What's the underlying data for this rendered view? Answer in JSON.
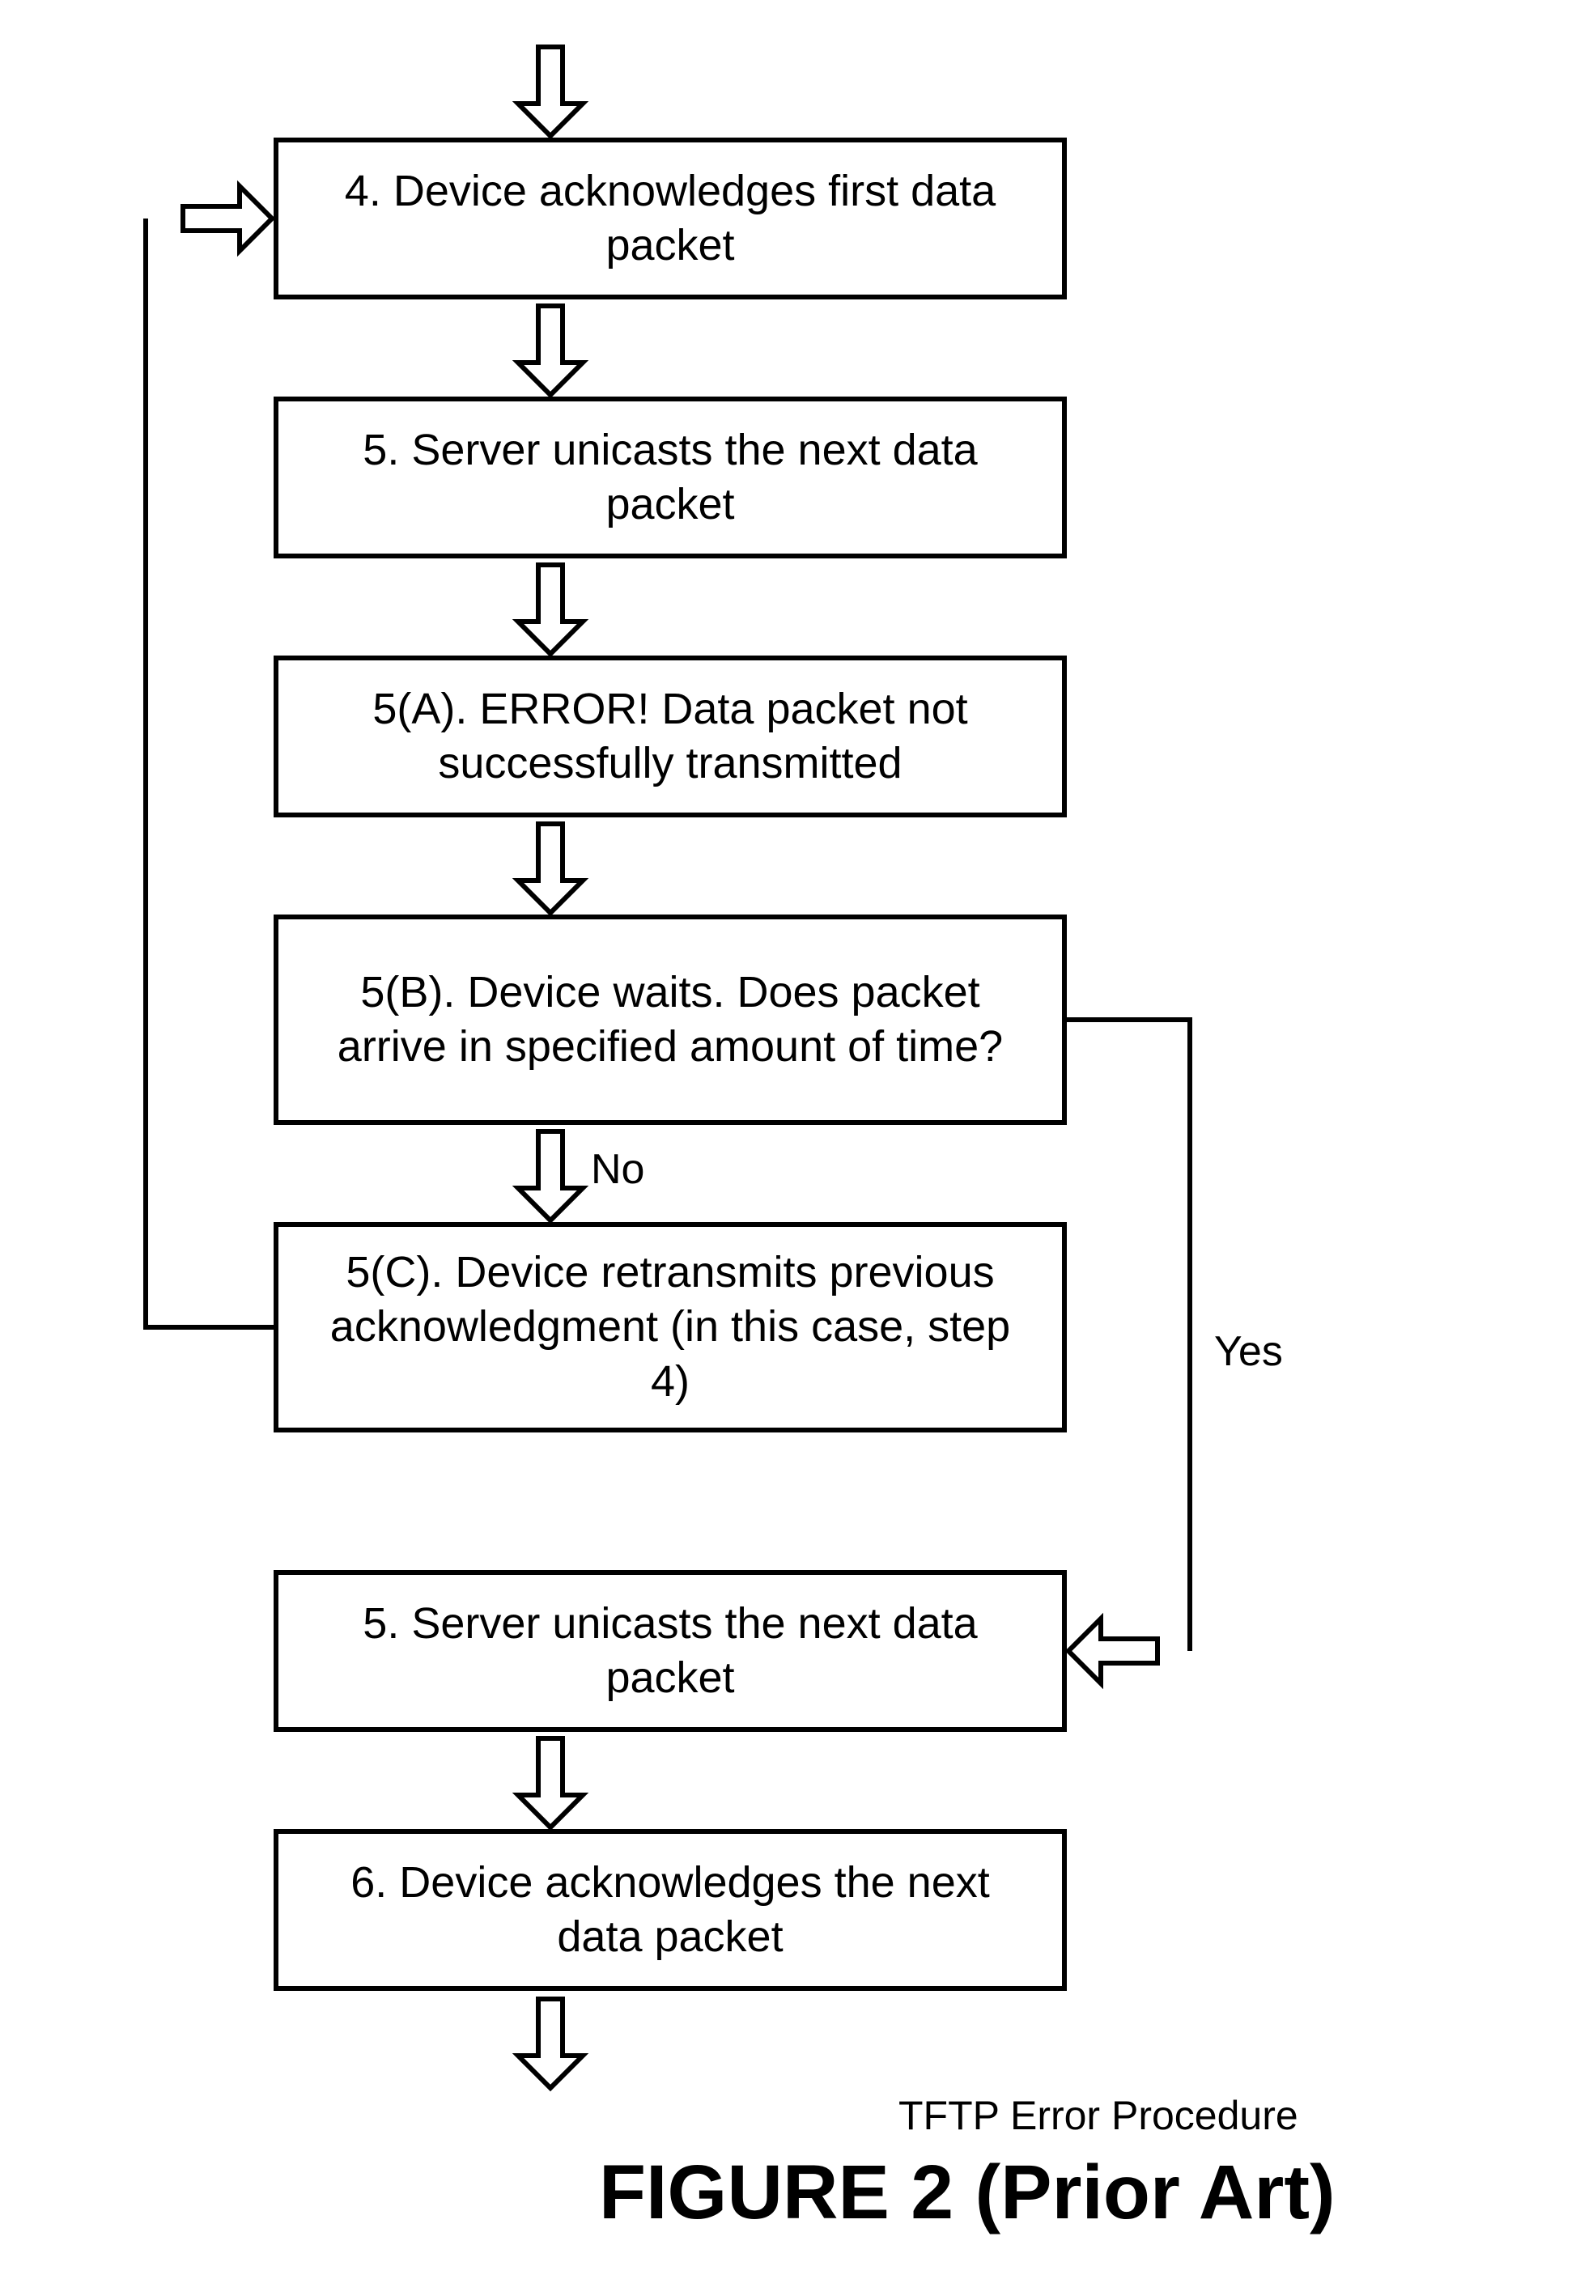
{
  "steps": {
    "s4": "4. Device acknowledges first data packet",
    "s5a": "5. Server unicasts the next data packet",
    "s5A": "5(A). ERROR! Data packet not successfully transmitted",
    "s5B": "5(B). Device waits. Does packet arrive in specified amount of time?",
    "s5C": "5(C). Device retransmits previous acknowledgment (in this case, step 4)",
    "s5b": "5. Server unicasts the next data packet",
    "s6": "6. Device acknowledges the next data packet"
  },
  "labels": {
    "no": "No",
    "yes": "Yes"
  },
  "caption": "TFTP Error Procedure",
  "figure_title": "FIGURE 2 (Prior Art)"
}
